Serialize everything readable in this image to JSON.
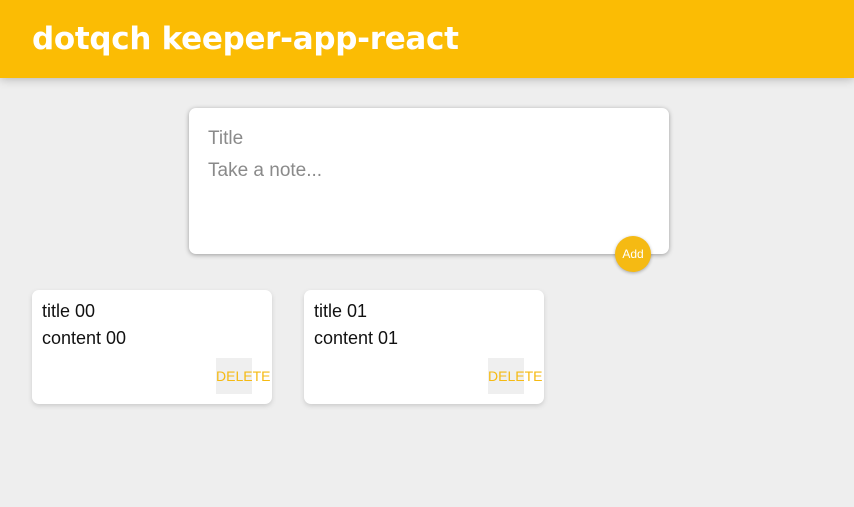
{
  "header": {
    "title": "dotqch keeper-app-react"
  },
  "create_note": {
    "title_placeholder": "Title",
    "content_placeholder": "Take a note...",
    "add_label": "Add"
  },
  "notes": [
    {
      "title": "title 00",
      "content": "content 00",
      "delete_label": "DELETE"
    },
    {
      "title": "title 01",
      "content": "content 01",
      "delete_label": "DELETE"
    }
  ],
  "colors": {
    "accent": "#fbbc04",
    "background": "#eeeeee",
    "card": "#ffffff"
  }
}
